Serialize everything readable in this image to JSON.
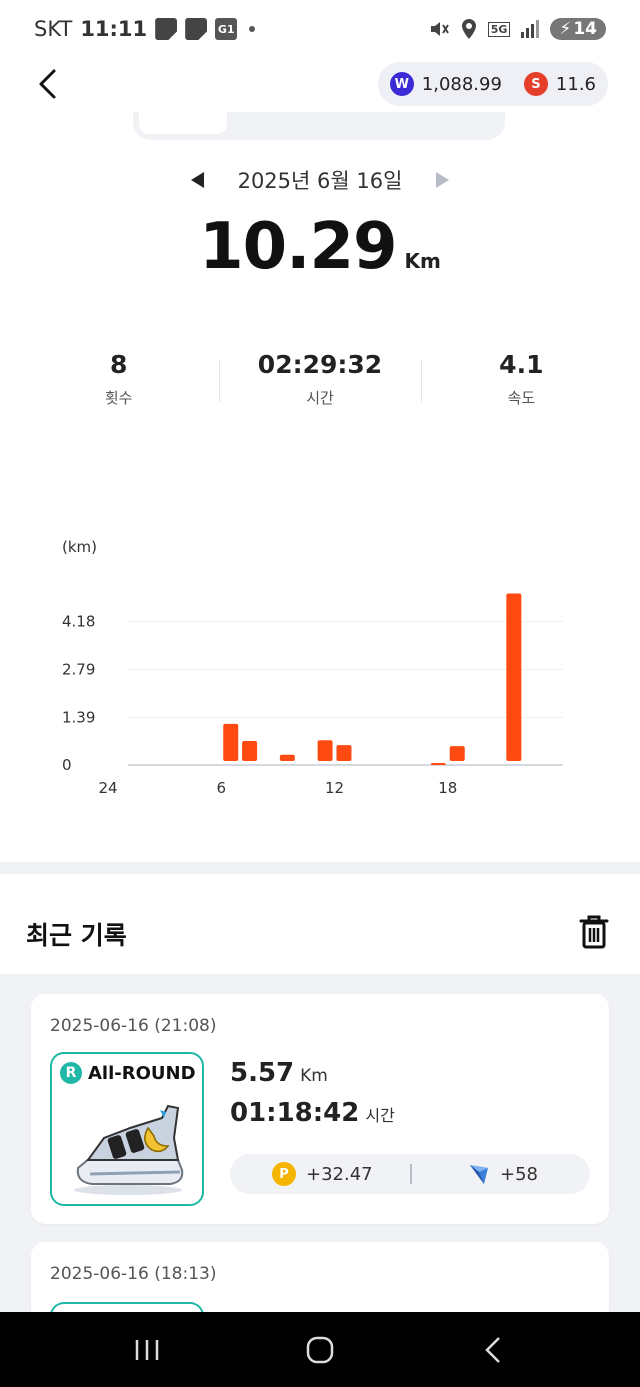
{
  "status_bar": {
    "carrier": "SKT",
    "time": "11:11",
    "notif_badge": "G1",
    "network": "5G",
    "battery": "14"
  },
  "header": {
    "balance_w": "1,088.99",
    "balance_s": "11.6",
    "coin_w_glyph": "W",
    "coin_s_glyph": "S"
  },
  "date_nav": {
    "date": "2025년 6월 16일"
  },
  "summary": {
    "distance": "10.29",
    "distance_unit": "Km"
  },
  "stats": [
    {
      "value": "8",
      "label": "횟수"
    },
    {
      "value": "02:29:32",
      "label": "시간"
    },
    {
      "value": "4.1",
      "label": "속도"
    }
  ],
  "chart_data": {
    "type": "bar",
    "unit_label": "(km)",
    "ytick_labels": [
      "4.18",
      "2.79",
      "1.39",
      "0"
    ],
    "yticks": [
      4.18,
      2.79,
      1.39,
      0
    ],
    "ylim": [
      0,
      5.57
    ],
    "xtick_labels": [
      "24",
      "6",
      "12",
      "18"
    ],
    "xticks": [
      0,
      6,
      12,
      18
    ],
    "xlim": [
      0,
      24
    ],
    "bar_color": "#ff4a12",
    "series": [
      {
        "x": [
          6,
          7,
          9,
          11,
          12,
          17,
          18,
          21
        ],
        "values": [
          1.2,
          0.7,
          0.3,
          0.72,
          0.58,
          0.06,
          0.55,
          5.0
        ]
      }
    ]
  },
  "recent": {
    "title": "최근 기록"
  },
  "records": [
    {
      "date": "2025-06-16 (21:08)",
      "shoe_badge": "R",
      "shoe_name": "All-ROUND",
      "distance": "5.57",
      "distance_unit": "Km",
      "duration": "01:18:42",
      "duration_unit": "시간",
      "point_glyph": "P",
      "points": "+32.47",
      "gems": "+58"
    },
    {
      "date": "2025-06-16 (18:13)"
    }
  ],
  "colors": {
    "accent_orange": "#ff4a12",
    "teal": "#1fb8a6",
    "background_gray": "#f1f2f5"
  }
}
